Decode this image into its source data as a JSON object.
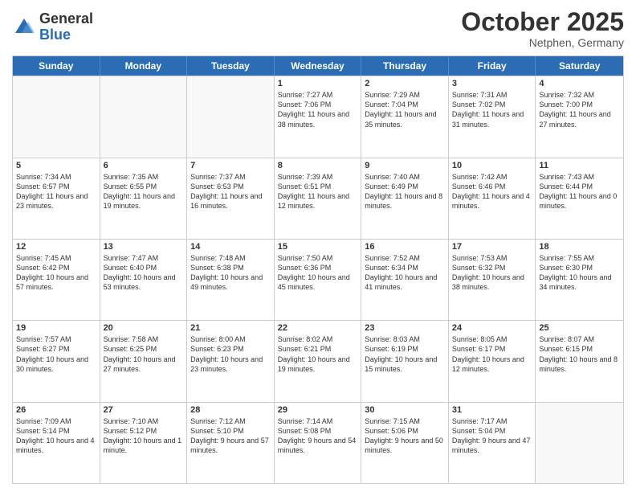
{
  "logo": {
    "general": "General",
    "blue": "Blue"
  },
  "title": "October 2025",
  "subtitle": "Netphen, Germany",
  "header_days": [
    "Sunday",
    "Monday",
    "Tuesday",
    "Wednesday",
    "Thursday",
    "Friday",
    "Saturday"
  ],
  "weeks": [
    [
      {
        "day": "",
        "text": ""
      },
      {
        "day": "",
        "text": ""
      },
      {
        "day": "",
        "text": ""
      },
      {
        "day": "1",
        "text": "Sunrise: 7:27 AM\nSunset: 7:06 PM\nDaylight: 11 hours and 38 minutes."
      },
      {
        "day": "2",
        "text": "Sunrise: 7:29 AM\nSunset: 7:04 PM\nDaylight: 11 hours and 35 minutes."
      },
      {
        "day": "3",
        "text": "Sunrise: 7:31 AM\nSunset: 7:02 PM\nDaylight: 11 hours and 31 minutes."
      },
      {
        "day": "4",
        "text": "Sunrise: 7:32 AM\nSunset: 7:00 PM\nDaylight: 11 hours and 27 minutes."
      }
    ],
    [
      {
        "day": "5",
        "text": "Sunrise: 7:34 AM\nSunset: 6:57 PM\nDaylight: 11 hours and 23 minutes."
      },
      {
        "day": "6",
        "text": "Sunrise: 7:35 AM\nSunset: 6:55 PM\nDaylight: 11 hours and 19 minutes."
      },
      {
        "day": "7",
        "text": "Sunrise: 7:37 AM\nSunset: 6:53 PM\nDaylight: 11 hours and 16 minutes."
      },
      {
        "day": "8",
        "text": "Sunrise: 7:39 AM\nSunset: 6:51 PM\nDaylight: 11 hours and 12 minutes."
      },
      {
        "day": "9",
        "text": "Sunrise: 7:40 AM\nSunset: 6:49 PM\nDaylight: 11 hours and 8 minutes."
      },
      {
        "day": "10",
        "text": "Sunrise: 7:42 AM\nSunset: 6:46 PM\nDaylight: 11 hours and 4 minutes."
      },
      {
        "day": "11",
        "text": "Sunrise: 7:43 AM\nSunset: 6:44 PM\nDaylight: 11 hours and 0 minutes."
      }
    ],
    [
      {
        "day": "12",
        "text": "Sunrise: 7:45 AM\nSunset: 6:42 PM\nDaylight: 10 hours and 57 minutes."
      },
      {
        "day": "13",
        "text": "Sunrise: 7:47 AM\nSunset: 6:40 PM\nDaylight: 10 hours and 53 minutes."
      },
      {
        "day": "14",
        "text": "Sunrise: 7:48 AM\nSunset: 6:38 PM\nDaylight: 10 hours and 49 minutes."
      },
      {
        "day": "15",
        "text": "Sunrise: 7:50 AM\nSunset: 6:36 PM\nDaylight: 10 hours and 45 minutes."
      },
      {
        "day": "16",
        "text": "Sunrise: 7:52 AM\nSunset: 6:34 PM\nDaylight: 10 hours and 41 minutes."
      },
      {
        "day": "17",
        "text": "Sunrise: 7:53 AM\nSunset: 6:32 PM\nDaylight: 10 hours and 38 minutes."
      },
      {
        "day": "18",
        "text": "Sunrise: 7:55 AM\nSunset: 6:30 PM\nDaylight: 10 hours and 34 minutes."
      }
    ],
    [
      {
        "day": "19",
        "text": "Sunrise: 7:57 AM\nSunset: 6:27 PM\nDaylight: 10 hours and 30 minutes."
      },
      {
        "day": "20",
        "text": "Sunrise: 7:58 AM\nSunset: 6:25 PM\nDaylight: 10 hours and 27 minutes."
      },
      {
        "day": "21",
        "text": "Sunrise: 8:00 AM\nSunset: 6:23 PM\nDaylight: 10 hours and 23 minutes."
      },
      {
        "day": "22",
        "text": "Sunrise: 8:02 AM\nSunset: 6:21 PM\nDaylight: 10 hours and 19 minutes."
      },
      {
        "day": "23",
        "text": "Sunrise: 8:03 AM\nSunset: 6:19 PM\nDaylight: 10 hours and 15 minutes."
      },
      {
        "day": "24",
        "text": "Sunrise: 8:05 AM\nSunset: 6:17 PM\nDaylight: 10 hours and 12 minutes."
      },
      {
        "day": "25",
        "text": "Sunrise: 8:07 AM\nSunset: 6:15 PM\nDaylight: 10 hours and 8 minutes."
      }
    ],
    [
      {
        "day": "26",
        "text": "Sunrise: 7:09 AM\nSunset: 5:14 PM\nDaylight: 10 hours and 4 minutes."
      },
      {
        "day": "27",
        "text": "Sunrise: 7:10 AM\nSunset: 5:12 PM\nDaylight: 10 hours and 1 minute."
      },
      {
        "day": "28",
        "text": "Sunrise: 7:12 AM\nSunset: 5:10 PM\nDaylight: 9 hours and 57 minutes."
      },
      {
        "day": "29",
        "text": "Sunrise: 7:14 AM\nSunset: 5:08 PM\nDaylight: 9 hours and 54 minutes."
      },
      {
        "day": "30",
        "text": "Sunrise: 7:15 AM\nSunset: 5:06 PM\nDaylight: 9 hours and 50 minutes."
      },
      {
        "day": "31",
        "text": "Sunrise: 7:17 AM\nSunset: 5:04 PM\nDaylight: 9 hours and 47 minutes."
      },
      {
        "day": "",
        "text": ""
      }
    ]
  ]
}
